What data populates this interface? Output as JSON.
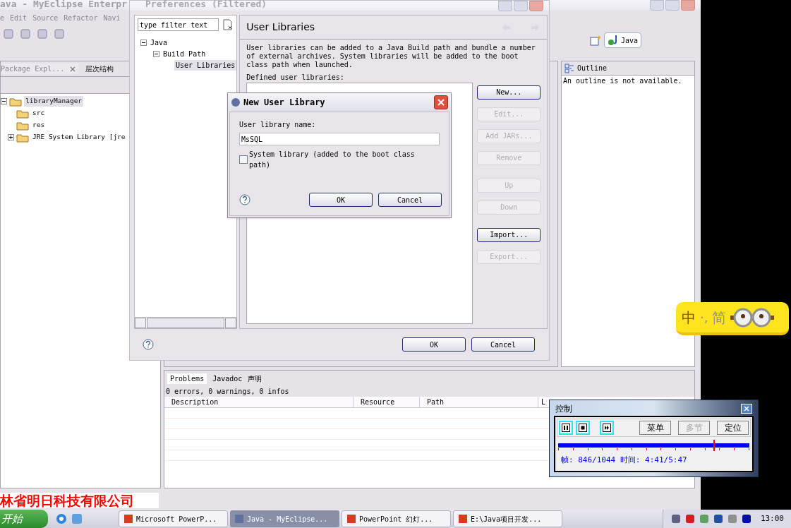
{
  "eclipse": {
    "title": "ava - MyEclipse Enterpr",
    "menu": [
      "e",
      "Edit",
      "Source",
      "Refactor",
      "Navi"
    ],
    "explorer": {
      "tabs": [
        {
          "label": "Package Expl...",
          "selected": true
        },
        {
          "label": "层次结构",
          "selected": false
        }
      ],
      "tree": [
        {
          "label": "libraryManager",
          "selected": true,
          "expanded": true,
          "children": [
            {
              "label": "src",
              "selected": false
            },
            {
              "label": "res",
              "selected": false
            },
            {
              "label": "JRE System Library [jre",
              "selected": false,
              "expanded": false
            }
          ]
        }
      ]
    },
    "perspective": "Java",
    "outline": {
      "tab": "Outline",
      "message": "An outline is not available."
    },
    "problems": {
      "tabs": [
        {
          "label": "Problems",
          "selected": true
        },
        {
          "label": "Javadoc",
          "selected": false
        },
        {
          "label": "声明",
          "selected": false
        }
      ],
      "summary": "0 errors, 0 warnings, 0 infos",
      "columns": [
        "Description",
        "Resource",
        "Path",
        "L"
      ]
    }
  },
  "preferences": {
    "title": "Preferences (Filtered)",
    "filter_placeholder": "type filter text",
    "tree": [
      {
        "label": "Java",
        "selected": false,
        "children": [
          {
            "label": "Build Path",
            "selected": false,
            "children": [
              {
                "label": "User Libraries",
                "selected": true
              }
            ]
          }
        ]
      }
    ],
    "page_title": "User Libraries",
    "description": "User libraries can be added to a Java Build path and bundle a number of external archives. System libraries will be added to the boot class path when launched.",
    "list_label": "Defined user libraries:",
    "side_buttons": [
      {
        "label": "New...",
        "disabled": false
      },
      {
        "label": "Edit...",
        "disabled": true
      },
      {
        "label": "Add JARs...",
        "disabled": true
      },
      {
        "label": "Remove",
        "disabled": true
      },
      {
        "label": "Up",
        "disabled": true
      },
      {
        "label": "Down",
        "disabled": true
      },
      {
        "label": "Import...",
        "disabled": false
      },
      {
        "label": "Export...",
        "disabled": true
      }
    ],
    "buttons": [
      "OK",
      "Cancel"
    ]
  },
  "new_library": {
    "title": "New User Library",
    "name_label": "User library name:",
    "name_value": "MsSQL",
    "system_library": {
      "label": "System library (added to the boot class path)",
      "checked": false
    },
    "buttons": [
      "OK",
      "Cancel"
    ]
  },
  "ime": {
    "mode": "中",
    "punctuation": "·,",
    "script": "简"
  },
  "player": {
    "title": "控制",
    "buttons": [
      {
        "label": "菜单",
        "disabled": false
      },
      {
        "label": "多节",
        "disabled": true
      },
      {
        "label": "定位",
        "disabled": false
      }
    ],
    "level": 0.81,
    "status": "帧: 846/1044 时间: 4:41/5:47"
  },
  "banner": "林省明日科技有限公司",
  "taskbar": {
    "start": "开始",
    "tasks": [
      {
        "label": "Microsoft PowerP...",
        "selected": false
      },
      {
        "label": "Java - MyEclipse...",
        "selected": true
      },
      {
        "label": "PowerPoint 幻灯...",
        "selected": false
      },
      {
        "label": "E:\\Java项目开发...",
        "selected": false
      }
    ],
    "clock": "13:00"
  }
}
